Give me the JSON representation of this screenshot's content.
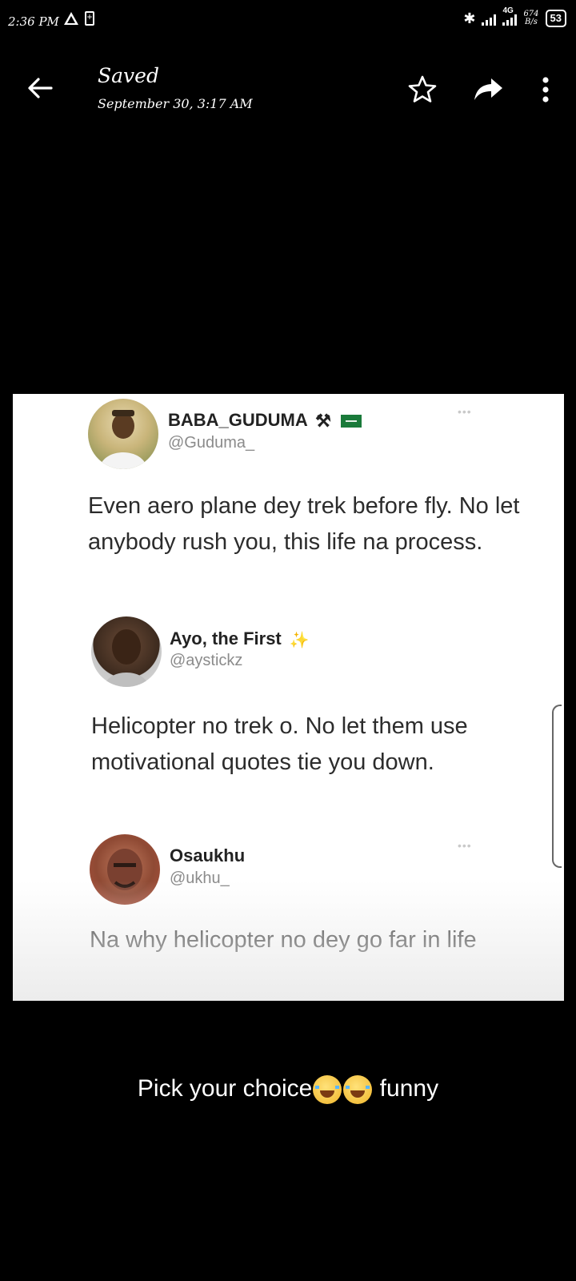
{
  "status_bar": {
    "time": "2:36 PM",
    "network_type": "4G",
    "data_speed_top": "674",
    "data_speed_bottom": "B/s",
    "battery_level": "53"
  },
  "app_bar": {
    "title": "Saved",
    "subtitle": "September 30, 3:17 AM"
  },
  "tweets": [
    {
      "name": "BABA_GUDUMA",
      "handle": "@Guduma_",
      "text": "Even aero plane dey trek before fly. No let anybody rush you, this life na process."
    },
    {
      "name": "Ayo, the First",
      "handle": "@aystickz",
      "text": "Helicopter no trek o. No let them use motivational quotes tie you down."
    },
    {
      "name": "Osaukhu",
      "handle": "@ukhu_",
      "text": "Na why helicopter no dey go far in life"
    }
  ],
  "caption": {
    "text_before": "Pick your choice",
    "text_after": " funny",
    "emoji": "joy-emoji"
  },
  "icons": {
    "back": "back-arrow-icon",
    "star": "star-icon",
    "share": "share-icon",
    "more": "more-vert-icon"
  }
}
